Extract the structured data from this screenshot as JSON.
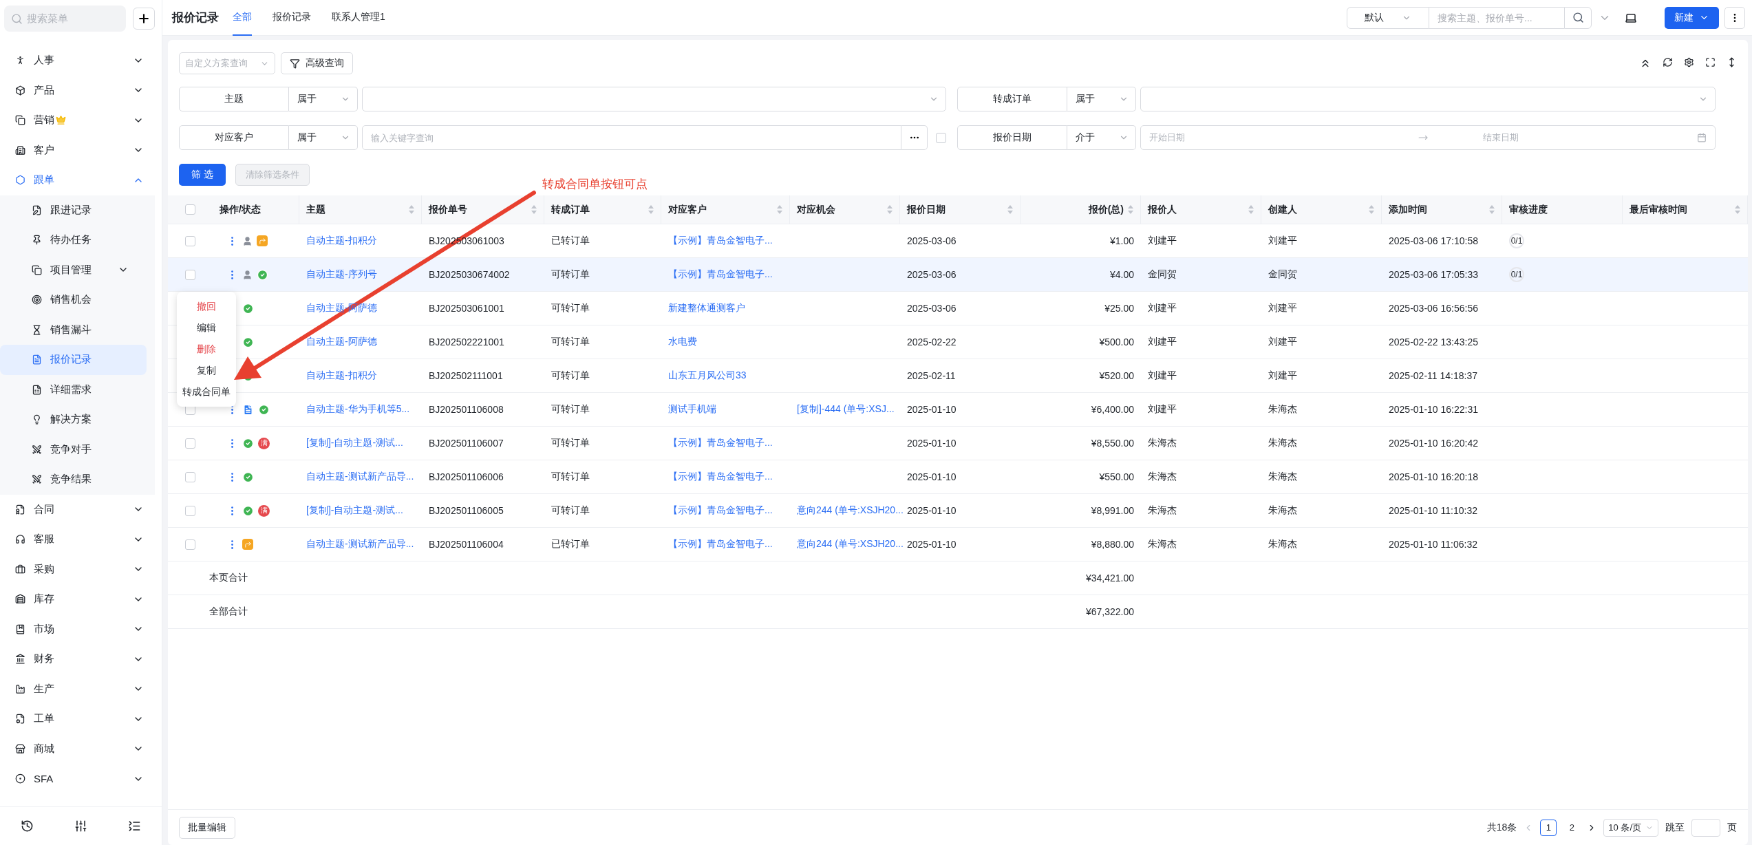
{
  "sidebar": {
    "search_placeholder": "搜索菜单",
    "items": [
      {
        "label": "人事",
        "expanded": false,
        "selected": false,
        "premium": false
      },
      {
        "label": "产品",
        "expanded": false,
        "selected": false,
        "premium": false
      },
      {
        "label": "营销",
        "expanded": false,
        "selected": false,
        "premium": true
      },
      {
        "label": "客户",
        "expanded": false,
        "selected": false,
        "premium": false
      },
      {
        "label": "跟单",
        "expanded": true,
        "selected": true,
        "premium": false,
        "children": [
          {
            "label": "跟进记录",
            "kind": "page",
            "selected": false
          },
          {
            "label": "待办任务",
            "kind": "page",
            "selected": false
          },
          {
            "label": "项目管理",
            "kind": "group",
            "expanded": false,
            "selected": false
          },
          {
            "label": "销售机会",
            "kind": "page",
            "selected": false
          },
          {
            "label": "销售漏斗",
            "kind": "page",
            "selected": false
          },
          {
            "label": "报价记录",
            "kind": "page",
            "selected": true
          },
          {
            "label": "详细需求",
            "kind": "page",
            "selected": false
          },
          {
            "label": "解决方案",
            "kind": "page",
            "selected": false
          },
          {
            "label": "竞争对手",
            "kind": "page",
            "selected": false
          },
          {
            "label": "竞争结果",
            "kind": "page",
            "selected": false
          }
        ]
      },
      {
        "label": "合同",
        "expanded": false,
        "selected": false,
        "premium": false
      },
      {
        "label": "客服",
        "expanded": false,
        "selected": false,
        "premium": false
      },
      {
        "label": "采购",
        "expanded": false,
        "selected": false,
        "premium": false
      },
      {
        "label": "库存",
        "expanded": false,
        "selected": false,
        "premium": false
      },
      {
        "label": "市场",
        "expanded": false,
        "selected": false,
        "premium": false
      },
      {
        "label": "财务",
        "expanded": false,
        "selected": false,
        "premium": false
      },
      {
        "label": "生产",
        "expanded": false,
        "selected": false,
        "premium": false
      },
      {
        "label": "工单",
        "expanded": false,
        "selected": false,
        "premium": false
      },
      {
        "label": "商城",
        "expanded": false,
        "selected": false,
        "premium": false
      },
      {
        "label": "SFA",
        "expanded": false,
        "selected": false,
        "premium": false
      }
    ]
  },
  "header": {
    "title": "报价记录",
    "tabs": [
      {
        "label": "全部",
        "selected": true
      },
      {
        "label": "报价记录",
        "selected": false
      },
      {
        "label": "联系人管理1",
        "selected": false
      }
    ],
    "view_select": "默认",
    "search_placeholder": "搜索主题、报价单号...",
    "new_button": "新建"
  },
  "toolbar": {
    "scheme_placeholder": "自定义方案查询",
    "advanced_button": "高级查询"
  },
  "filters": [
    {
      "label": "主题",
      "operator": "属于",
      "kind": "select"
    },
    {
      "label": "转成订单",
      "operator": "属于",
      "kind": "select"
    },
    {
      "label": "对应客户",
      "operator": "属于",
      "kind": "keyword",
      "placeholder": "输入关键字查询",
      "checked": false
    },
    {
      "label": "报价日期",
      "operator": "介于",
      "kind": "daterange",
      "start_placeholder": "开始日期",
      "end_placeholder": "结束日期"
    }
  ],
  "filter_buttons": {
    "apply": "筛 选",
    "clear": "清除筛选条件",
    "clear_disabled": true
  },
  "annotation": {
    "text": "转成合同单按钮可点"
  },
  "table": {
    "select_all_checked": false,
    "columns": [
      {
        "label": "操作/状态",
        "sortable": false
      },
      {
        "label": "主题",
        "sortable": true
      },
      {
        "label": "报价单号",
        "sortable": true
      },
      {
        "label": "转成订单",
        "sortable": true
      },
      {
        "label": "对应客户",
        "sortable": true
      },
      {
        "label": "对应机会",
        "sortable": true
      },
      {
        "label": "报价日期",
        "sortable": true
      },
      {
        "label": "报价(总)",
        "sortable": true
      },
      {
        "label": "报价人",
        "sortable": true
      },
      {
        "label": "创建人",
        "sortable": true
      },
      {
        "label": "添加时间",
        "sortable": true
      },
      {
        "label": "审核进度",
        "sortable": false
      },
      {
        "label": "最后审核时间",
        "sortable": true
      }
    ],
    "rows": [
      {
        "checked": false,
        "selected": false,
        "status": [
          {
            "kind": "person"
          },
          {
            "kind": "forwarded"
          }
        ],
        "subject": "自动主题-扣积分",
        "quote_no": "BJ202503061003",
        "convert": "已转订单",
        "customer": "【示例】青岛金智电子...",
        "date": "2025-03-06",
        "total": "¥1.00",
        "quoter": "刘建平",
        "creator": "刘建平",
        "added": "2025-03-06 17:10:58",
        "review": "0/1"
      },
      {
        "checked": false,
        "selected": true,
        "status": [
          {
            "kind": "person"
          },
          {
            "kind": "approved"
          }
        ],
        "subject": "自动主题-序列号",
        "quote_no": "BJ2025030674002",
        "convert": "可转订单",
        "customer": "【示例】青岛金智电子...",
        "date": "2025-03-06",
        "total": "¥4.00",
        "quoter": "金同贺",
        "creator": "金同贺",
        "added": "2025-03-06 17:05:33",
        "review": "0/1"
      },
      {
        "selected": false,
        "status": [
          {
            "kind": "approved"
          }
        ],
        "subject": "自动主题-阿萨德",
        "quote_no": "BJ202503061001",
        "convert": "可转订单",
        "customer": "新建整体通测客户",
        "date": "2025-03-06",
        "total": "¥25.00",
        "quoter": "刘建平",
        "creator": "刘建平",
        "added": "2025-03-06 16:56:56"
      },
      {
        "selected": false,
        "status": [
          {
            "kind": "approved"
          }
        ],
        "subject": "自动主题-阿萨德",
        "quote_no": "BJ202502221001",
        "convert": "可转订单",
        "customer": "水电费",
        "date": "2025-02-22",
        "total": "¥500.00",
        "quoter": "刘建平",
        "creator": "刘建平",
        "added": "2025-02-22 13:43:25"
      },
      {
        "selected": false,
        "status": [
          {
            "kind": "approved"
          }
        ],
        "subject": "自动主题-扣积分",
        "quote_no": "BJ202502111001",
        "convert": "可转订单",
        "customer": "山东五月风公司33",
        "date": "2025-02-11",
        "total": "¥520.00",
        "quoter": "刘建平",
        "creator": "刘建平",
        "added": "2025-02-11 14:18:37"
      },
      {
        "checked": false,
        "selected": false,
        "status": [
          {
            "kind": "document"
          },
          {
            "kind": "approved"
          }
        ],
        "subject": "自动主题-华为手机等5...",
        "quote_no": "BJ202501106008",
        "convert": "可转订单",
        "customer": "测试手机端",
        "opportunity": "[复制]-444 (单号:XSJ...",
        "date": "2025-01-10",
        "total": "¥6,400.00",
        "quoter": "刘建平",
        "creator": "朱海杰",
        "added": "2025-01-10 16:22:31"
      },
      {
        "checked": false,
        "selected": false,
        "status": [
          {
            "kind": "approved"
          },
          {
            "kind": "full",
            "text": "满"
          }
        ],
        "subject": "[复制]-自动主题-测试...",
        "quote_no": "BJ202501106007",
        "convert": "可转订单",
        "customer": "【示例】青岛金智电子...",
        "date": "2025-01-10",
        "total": "¥8,550.00",
        "quoter": "朱海杰",
        "creator": "朱海杰",
        "added": "2025-01-10 16:20:42"
      },
      {
        "checked": false,
        "selected": false,
        "status": [
          {
            "kind": "approved"
          }
        ],
        "subject": "自动主题-测试新产品导...",
        "quote_no": "BJ202501106006",
        "convert": "可转订单",
        "customer": "【示例】青岛金智电子...",
        "date": "2025-01-10",
        "total": "¥550.00",
        "quoter": "朱海杰",
        "creator": "朱海杰",
        "added": "2025-01-10 16:20:18"
      },
      {
        "checked": false,
        "selected": false,
        "status": [
          {
            "kind": "approved"
          },
          {
            "kind": "full",
            "text": "满"
          }
        ],
        "subject": "[复制]-自动主题-测试...",
        "quote_no": "BJ202501106005",
        "convert": "可转订单",
        "customer": "【示例】青岛金智电子...",
        "opportunity": "意向244 (单号:XSJH20...",
        "date": "2025-01-10",
        "total": "¥8,991.00",
        "quoter": "朱海杰",
        "creator": "朱海杰",
        "added": "2025-01-10 11:10:32"
      },
      {
        "checked": false,
        "selected": false,
        "status": [
          {
            "kind": "forwarded"
          }
        ],
        "subject": "自动主题-测试新产品导...",
        "quote_no": "BJ202501106004",
        "convert": "已转订单",
        "customer": "【示例】青岛金智电子...",
        "opportunity": "意向244 (单号:XSJH20...",
        "date": "2025-01-10",
        "total": "¥8,880.00",
        "quoter": "朱海杰",
        "creator": "朱海杰",
        "added": "2025-01-10 11:06:32"
      }
    ],
    "totals": [
      {
        "label": "本页合计",
        "total": "¥34,421.00"
      },
      {
        "label": "全部合计",
        "total": "¥67,322.00"
      }
    ]
  },
  "row_menu": {
    "items": [
      {
        "label": "撤回",
        "danger": true
      },
      {
        "label": "编辑",
        "danger": false
      },
      {
        "label": "删除",
        "danger": true
      },
      {
        "label": "复制",
        "danger": false
      },
      {
        "label": "转成合同单",
        "danger": false
      }
    ]
  },
  "footer": {
    "batch_button": "批量编辑",
    "total": "共18条",
    "pages": [
      {
        "label": "1",
        "selected": true
      },
      {
        "label": "2",
        "selected": false
      }
    ],
    "page_size": "10 条/页",
    "jump_label": "跳至",
    "page_unit": "页"
  }
}
